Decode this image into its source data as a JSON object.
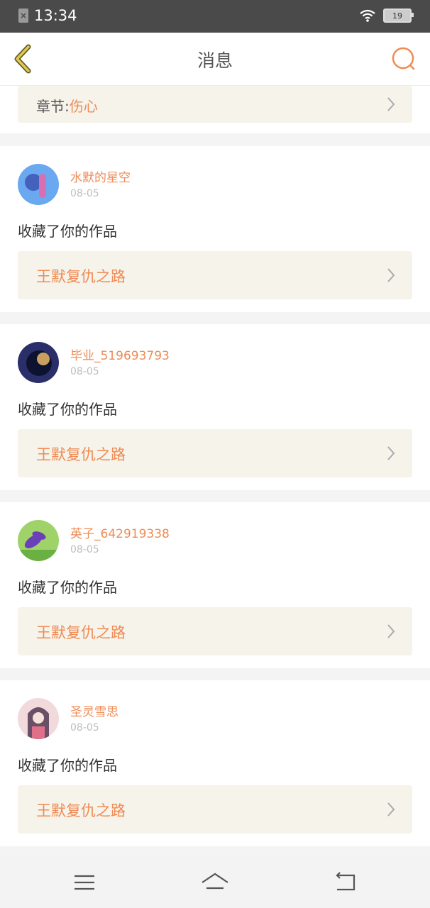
{
  "status_bar": {
    "time": "13:34",
    "battery": "19"
  },
  "header": {
    "title": "消息"
  },
  "top_card": {
    "chapter_label": "章节:",
    "chapter_name": "伤心"
  },
  "messages": [
    {
      "username": "水默的星空",
      "date": "08-05",
      "action": "收藏了你的作品",
      "work_title": "王默复仇之路",
      "avatar_colors": [
        "#6aa8f0",
        "#3a4fb0",
        "#d86fb0"
      ]
    },
    {
      "username": "毕业_519693793",
      "date": "08-05",
      "action": "收藏了你的作品",
      "work_title": "王默复仇之路",
      "avatar_colors": [
        "#2a2f6a",
        "#0d1230",
        "#c9a060"
      ]
    },
    {
      "username": "英子_642919338",
      "date": "08-05",
      "action": "收藏了你的作品",
      "work_title": "王默复仇之路",
      "avatar_colors": [
        "#9fd36a",
        "#4a9a2a",
        "#6a3fb8"
      ]
    },
    {
      "username": "圣灵雪思",
      "date": "08-05",
      "action": "收藏了你的作品",
      "work_title": "王默复仇之路",
      "avatar_colors": [
        "#f1d9dc",
        "#6a5066",
        "#e0708a"
      ]
    }
  ],
  "colors": {
    "accent": "#ef8b55",
    "link_bg": "#f5f3ea",
    "status_bar": "#4a4a4a"
  },
  "icons": [
    "back-icon",
    "search-icon",
    "chevron-right-icon",
    "menu-icon",
    "home-icon",
    "return-icon",
    "wifi-icon",
    "battery-icon",
    "sim-icon"
  ]
}
